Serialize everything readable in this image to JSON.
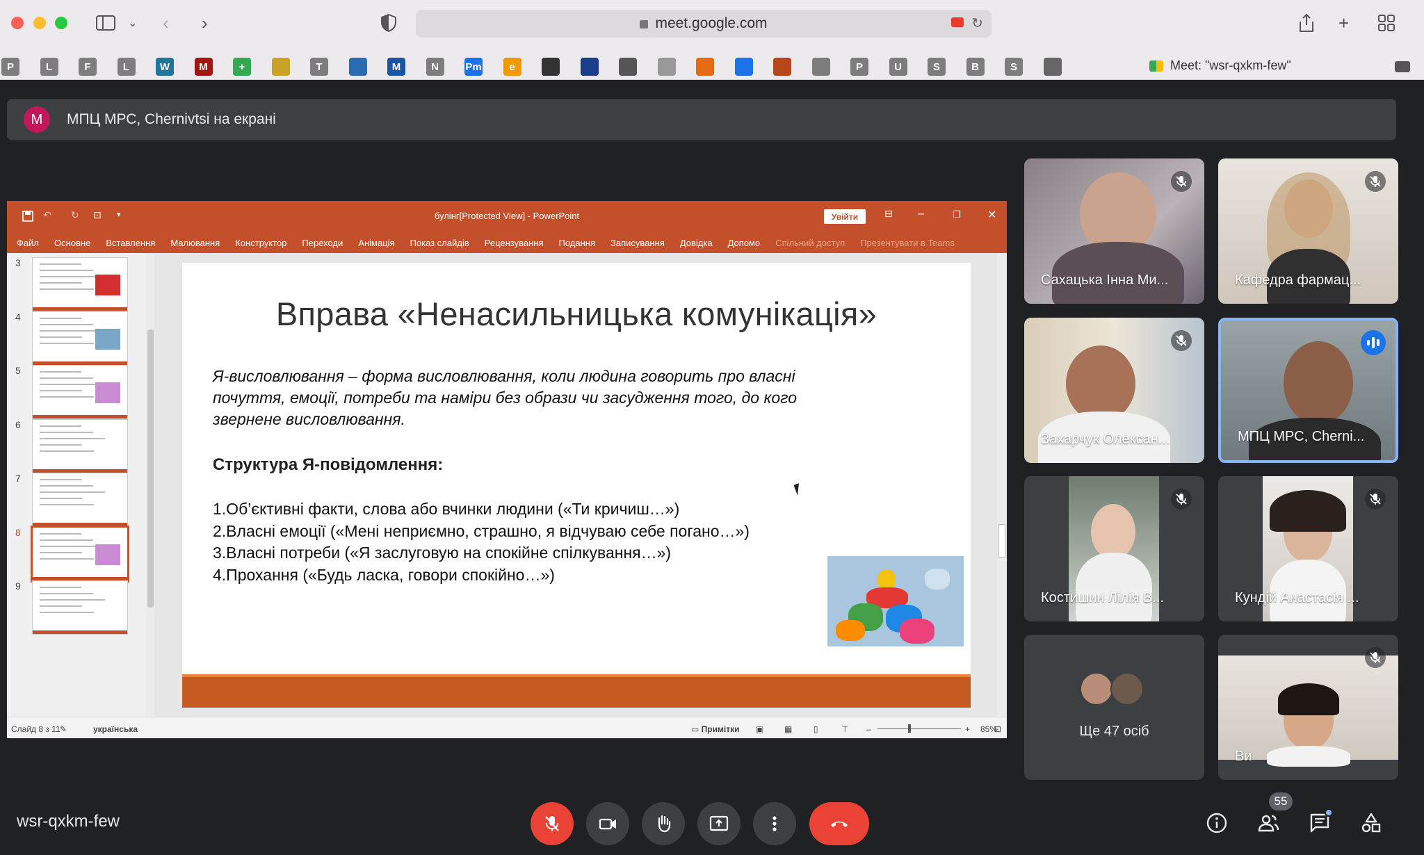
{
  "browser": {
    "url": "meet.google.com",
    "tab_title": "Meet: \"wsr-qxkm-few\"",
    "bookmarks": [
      "P",
      "L",
      "F",
      "L",
      "W",
      "M",
      "+",
      "",
      "T",
      "",
      "M",
      "N",
      "Pm",
      "e",
      "",
      "",
      "",
      "",
      "",
      "",
      "",
      "",
      "P",
      "U",
      "S",
      "B",
      "S",
      ""
    ]
  },
  "presenter": {
    "avatar_letter": "M",
    "text": "МПЦ МРС, Chernivtsi на екрані"
  },
  "powerpoint": {
    "doc_title": "булінг[Protected View]  -  PowerPoint",
    "signin": "Увійти",
    "menu": [
      "Файл",
      "Основне",
      "Вставлення",
      "Малювання",
      "Конструктор",
      "Переходи",
      "Анімація",
      "Показ слайдів",
      "Рецензування",
      "Подання",
      "Записування",
      "Довідка",
      "Допомо"
    ],
    "menu_right": [
      "Спільний доступ",
      "Презентувати в Teams"
    ],
    "thumb_numbers": [
      "3",
      "4",
      "5",
      "6",
      "7",
      "8",
      "9"
    ],
    "active_thumb": "8",
    "status_slide": "Слайд 8 з 11",
    "status_lang": "українська",
    "notes": "Примітки",
    "zoom": "85%"
  },
  "slide": {
    "title": "Вправа «Ненасильницька комунікація»",
    "paragraph_1": "Я-висловлювання – форма висловлювання, коли людина говорить про власні",
    "paragraph_2": "почуття, емоції, потреби та наміри без образи чи засудження того, до кого",
    "paragraph_3": "звернене висловлювання.",
    "structure_title": "Структура Я-повідомлення:",
    "items": [
      "1.Об’єктивні факти, слова або вчинки людини («Ти кричиш…»)",
      "2.Власні емоції («Мені неприємно, страшно, я відчуваю себе погано…»)",
      "3.Власні потреби («Я заслуговую на спокійне спілкування…»)",
      "4.Прохання («Будь ласка, говори спокійно…»)"
    ]
  },
  "participants": [
    {
      "name": "Сахацька Інна Ми...",
      "muted": true
    },
    {
      "name": "Кафедра фармац...",
      "muted": true
    },
    {
      "name": "Захарчук Олексан...",
      "muted": true
    },
    {
      "name": "МПЦ МРС, Cherni...",
      "muted": false
    },
    {
      "name": "Костишин Лілія В...",
      "muted": true
    },
    {
      "name": "Кундій Анастасія ...",
      "muted": true
    },
    {
      "name": "Ви",
      "muted": true
    }
  ],
  "more": {
    "label": "Ще 47 осіб"
  },
  "bottom": {
    "meeting_code": "wsr-qxkm-few",
    "people_count": "55"
  },
  "colors": {
    "meet_bg": "#202124",
    "ppt_accent": "#c3502a",
    "hangup": "#ea4335",
    "speaking": "#1a73e8"
  }
}
